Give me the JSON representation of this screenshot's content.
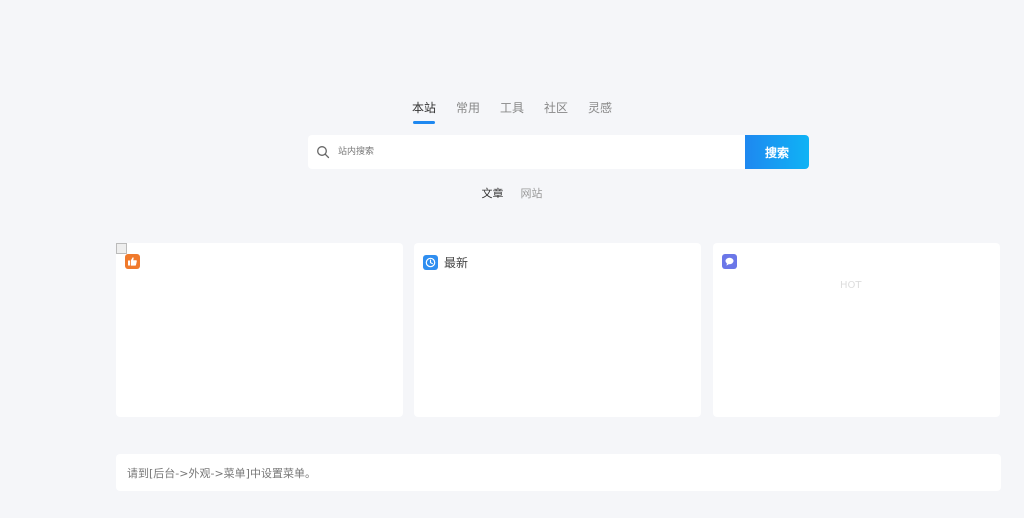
{
  "engine_tabs": [
    {
      "label": "本站",
      "active": true
    },
    {
      "label": "常用",
      "active": false
    },
    {
      "label": "工具",
      "active": false
    },
    {
      "label": "社区",
      "active": false
    },
    {
      "label": "灵感",
      "active": false
    }
  ],
  "search": {
    "placeholder": "站内搜索",
    "value": "",
    "button_label": "搜索",
    "icon": "search-icon"
  },
  "scope_tabs": [
    {
      "label": "文章",
      "active": true
    },
    {
      "label": "网站",
      "active": false
    }
  ],
  "cards": [
    {
      "title": "",
      "icon": "thumbs-up-icon",
      "icon_color": "#f07a2c"
    },
    {
      "title": "最新",
      "icon": "clock-icon",
      "icon_color": "#2f8ef0"
    },
    {
      "title": "",
      "icon": "chat-bubble-icon",
      "icon_color": "#6b77e8",
      "badge": "HOT"
    }
  ],
  "footer": {
    "menu_hint": "请到[后台->外观->菜单]中设置菜单。"
  },
  "colors": {
    "accent": "#1e88f0",
    "background": "#f5f6f9"
  }
}
